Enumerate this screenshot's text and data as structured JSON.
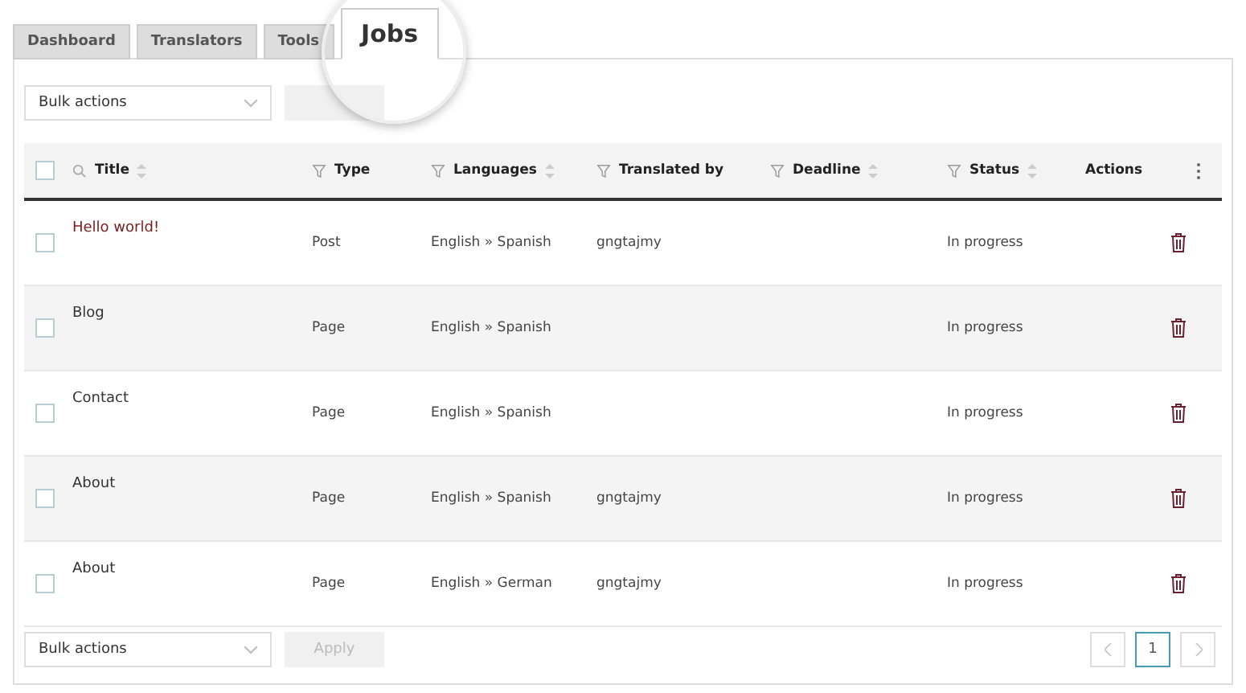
{
  "tabs": [
    {
      "label": "Dashboard",
      "selected": false
    },
    {
      "label": "Translators",
      "selected": false
    },
    {
      "label": "Tools",
      "selected": false
    },
    {
      "label": "Jobs",
      "selected": true
    }
  ],
  "bulk_top": {
    "value": "Bulk actions"
  },
  "table": {
    "select_all_checked": false,
    "columns": [
      {
        "label": "Title",
        "search": true,
        "filter": false,
        "sortable": true
      },
      {
        "label": "Type",
        "search": false,
        "filter": true,
        "sortable": false
      },
      {
        "label": "Languages",
        "search": false,
        "filter": true,
        "sortable": true
      },
      {
        "label": "Translated by",
        "search": false,
        "filter": true,
        "sortable": false
      },
      {
        "label": "Deadline",
        "search": false,
        "filter": true,
        "sortable": true
      },
      {
        "label": "Status",
        "search": false,
        "filter": true,
        "sortable": true
      },
      {
        "label": "Actions",
        "search": false,
        "filter": false,
        "sortable": false
      }
    ],
    "rows": [
      {
        "title": "Hello world!",
        "type": "Post",
        "languages": "English » Spanish",
        "translated_by": "gngtajmy",
        "status": "In progress",
        "checked": false
      },
      {
        "title": "Blog",
        "type": "Page",
        "languages": "English » Spanish",
        "status": "In progress",
        "checked": false
      },
      {
        "title": "Contact",
        "type": "Page",
        "languages": "English » Spanish",
        "status": "In progress",
        "checked": false
      },
      {
        "title": "About",
        "type": "Page",
        "languages": "English » Spanish",
        "translated_by": "gngtajmy",
        "status": "In progress",
        "checked": false
      },
      {
        "title": "About",
        "type": "Page",
        "languages": "English » German",
        "translated_by": "gngtajmy",
        "status": "In progress",
        "checked": false
      }
    ]
  },
  "bulk_bottom": {
    "value": "Bulk actions",
    "apply": "Apply"
  },
  "pagination": {
    "pages": [
      {
        "label": "1",
        "selected": true
      }
    ]
  }
}
